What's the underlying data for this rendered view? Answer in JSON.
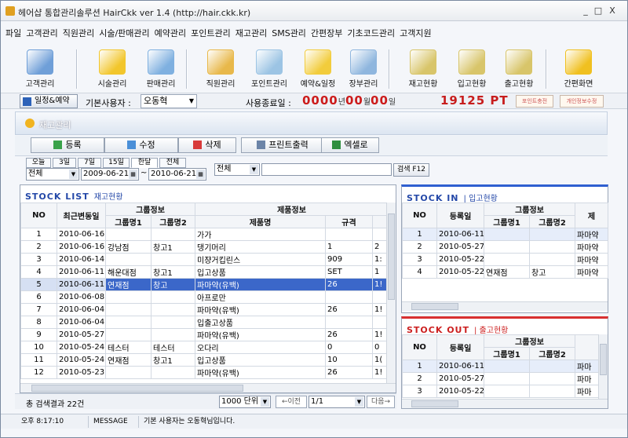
{
  "window": {
    "title": "헤어샵 통합관리솔루션 HairCkk ver 1.4 (http://hair.ckk.kr)",
    "min": "_",
    "max": "□",
    "close": "X"
  },
  "menu": [
    "파일",
    "고객관리",
    "직원관리",
    "시술/판매관리",
    "예약관리",
    "포인트관리",
    "재고관리",
    "SMS관리",
    "간편장부",
    "기초코드관리",
    "고객지원"
  ],
  "toolbar": [
    {
      "label": "고객관리",
      "icon": "customer-card-icon",
      "color": "#6f9fd8"
    },
    {
      "label": "시술관리",
      "icon": "scissors-smiley-icon",
      "color": "#f2c62c"
    },
    {
      "label": "판매관리",
      "icon": "sales-product-icon",
      "color": "#7fb0e0"
    },
    {
      "label": "직원관리",
      "icon": "staff-person-icon",
      "color": "#e8b84a"
    },
    {
      "label": "포인트관리",
      "icon": "calculator-icon",
      "color": "#9cc4e4"
    },
    {
      "label": "예약&일정",
      "icon": "alarm-clock-icon",
      "color": "#f2cc3c"
    },
    {
      "label": "장부관리",
      "icon": "ledger-pencil-icon",
      "color": "#8fb6de"
    },
    {
      "label": "재고현황",
      "icon": "database-stack-icon",
      "color": "#d8c56a"
    },
    {
      "label": "입고현황",
      "icon": "database-add-icon",
      "color": "#d8c56a"
    },
    {
      "label": "출고현황",
      "icon": "database-remove-icon",
      "color": "#d8c56a"
    },
    {
      "label": "간편화면",
      "icon": "windows-icon",
      "color": "#f0c020"
    }
  ],
  "statusrow": {
    "schedule_button": "일정&예약",
    "default_user_label": "기본사용자 :",
    "default_user": "오동혁",
    "end_date_label": "사용종료일 :",
    "year": "0000",
    "year_unit": "년",
    "month": "00",
    "month_unit": "월",
    "day": "00",
    "day_unit": "일",
    "points": "19125 PT",
    "point_charge": "포인트충전",
    "profile_edit": "개인정보수정"
  },
  "section_title": "재고관리",
  "actions": [
    {
      "label": "등록",
      "icon": "register-icon",
      "color": "#3aa24a"
    },
    {
      "label": "수정",
      "icon": "edit-pencil-icon",
      "color": "#4a8fd8"
    },
    {
      "label": "삭제",
      "icon": "delete-icon",
      "color": "#d83a3a"
    },
    {
      "label": "프린트출력",
      "icon": "printer-icon",
      "color": "#6b84a8"
    },
    {
      "label": "엑셀로",
      "icon": "excel-icon",
      "color": "#2f8f3f"
    }
  ],
  "date_tabs": [
    "오늘",
    "3일",
    "7일",
    "15일",
    "한달",
    "전체"
  ],
  "active_tab": 4,
  "filter": {
    "scope": "전체",
    "date_from": "2009-06-21",
    "tilde": "~",
    "date_to": "2010-06-21",
    "field": "전체",
    "search_value": "",
    "search_button": "검색 F12"
  },
  "stock_list": {
    "title": "STOCK LIST",
    "subtitle": "재고현황",
    "headers": {
      "no": "NO",
      "date": "최근변동일",
      "group": "그룹정보",
      "group1": "그룹명1",
      "group2": "그룹명2",
      "product": "제품정보",
      "name": "제품명",
      "spec": "규격"
    },
    "rows": [
      [
        "1",
        "2010-06-16",
        "",
        "",
        "가가",
        "",
        ""
      ],
      [
        "2",
        "2010-06-16",
        "강남점",
        "창고1",
        "댕기머리",
        "1",
        "2"
      ],
      [
        "3",
        "2010-06-14",
        "",
        "",
        "미쟝거킵린스",
        "909",
        "1:"
      ],
      [
        "4",
        "2010-06-11",
        "해운대점",
        "창고1",
        "입고상품",
        "SET",
        "1"
      ],
      [
        "5",
        "2010-06-11",
        "연재점",
        "창고",
        "파마약(유백)",
        "26",
        "1!"
      ],
      [
        "6",
        "2010-06-08",
        "",
        "",
        "아프로만",
        "",
        ""
      ],
      [
        "7",
        "2010-06-04",
        "",
        "",
        "파마약(유백)",
        "26",
        "1!"
      ],
      [
        "8",
        "2010-06-04",
        "",
        "",
        "입출고상품",
        "",
        ""
      ],
      [
        "9",
        "2010-05-27",
        "",
        "",
        "파마약(유백)",
        "26",
        "1!"
      ],
      [
        "10",
        "2010-05-24",
        "테스터",
        "테스터",
        "오다리",
        "0",
        "0"
      ],
      [
        "11",
        "2010-05-24",
        "연재점",
        "창고1",
        "입고상품",
        "10",
        "1("
      ],
      [
        "12",
        "2010-05-23",
        "",
        "",
        "파마약(유백)",
        "26",
        "1!"
      ]
    ],
    "selected_index": 4
  },
  "stock_in": {
    "title": "STOCK IN",
    "subtitle": "| 입고현황",
    "headers": {
      "no": "NO",
      "date": "등록일",
      "group": "그룹정보",
      "group1": "그룹명1",
      "group2": "그룹명2",
      "product": "제"
    },
    "rows": [
      [
        "1",
        "2010-06-11",
        "",
        "",
        "파마약"
      ],
      [
        "2",
        "2010-05-27",
        "",
        "",
        "파마약"
      ],
      [
        "3",
        "2010-05-22",
        "",
        "",
        "파마약"
      ],
      [
        "4",
        "2010-05-22",
        "연재점",
        "창고",
        "파마약"
      ]
    ]
  },
  "stock_out": {
    "title": "STOCK OUT",
    "subtitle": "| 출고현황",
    "headers": {
      "no": "NO",
      "date": "등록일",
      "group": "그룹정보",
      "group1": "그룹명1",
      "group2": "그룹명2"
    },
    "rows": [
      [
        "1",
        "2010-06-11",
        "",
        "",
        "파마"
      ],
      [
        "2",
        "2010-05-27",
        "",
        "",
        "파마"
      ],
      [
        "3",
        "2010-05-22",
        "",
        "",
        "파마"
      ]
    ]
  },
  "pager": {
    "result": "총 검색결과 22건",
    "page_size": "1000 단위",
    "prev": "←이전",
    "page": "1/1",
    "next": "다음→"
  },
  "statusbar": {
    "time": "오후 8:17:10",
    "message_label": "MESSAGE",
    "message": "기본 사용자는 오동혁님입니다."
  }
}
